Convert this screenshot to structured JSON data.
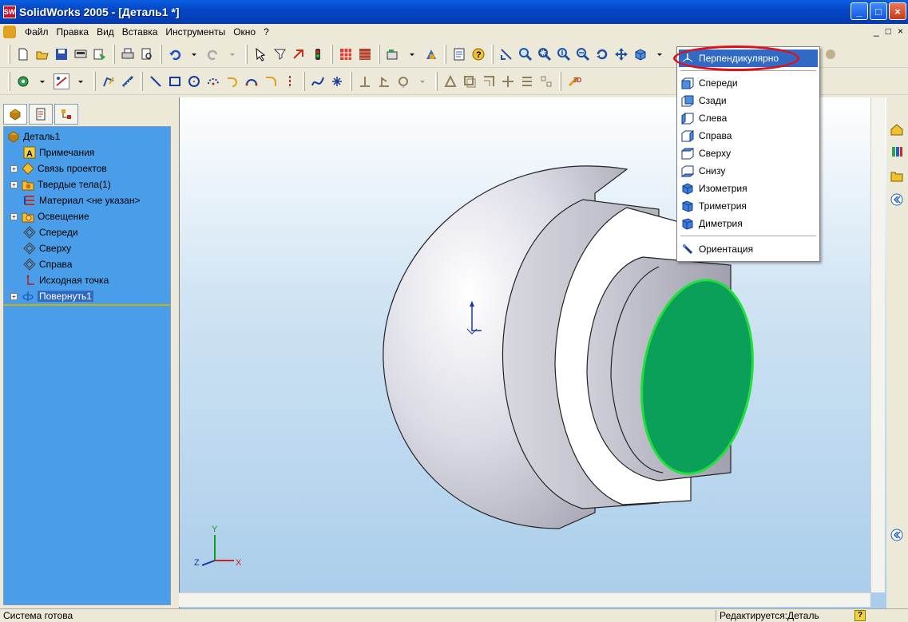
{
  "window": {
    "title": "SolidWorks 2005 - [Деталь1 *]",
    "logo_text": "SW",
    "minimize": "_",
    "maximize": "□",
    "close": "×"
  },
  "menu": {
    "items": [
      "Файл",
      "Правка",
      "Вид",
      "Вставка",
      "Инструменты",
      "Окно",
      "?"
    ],
    "mdi": [
      "_",
      "□",
      "×"
    ]
  },
  "feature_tree": {
    "items": [
      {
        "label": "Деталь1",
        "icon": "part-icon",
        "expander": false
      },
      {
        "label": "Примечания",
        "icon": "annotations-icon",
        "expander": false
      },
      {
        "label": "Связь проектов",
        "icon": "design-binder-icon",
        "expander": true
      },
      {
        "label": "Твердые тела(1)",
        "icon": "solid-bodies-icon",
        "expander": true
      },
      {
        "label": "Материал <не указан>",
        "icon": "material-icon",
        "expander": false
      },
      {
        "label": "Освещение",
        "icon": "lighting-icon",
        "expander": true
      },
      {
        "label": "Спереди",
        "icon": "plane-icon",
        "expander": false
      },
      {
        "label": "Сверху",
        "icon": "plane-icon",
        "expander": false
      },
      {
        "label": "Справа",
        "icon": "plane-icon",
        "expander": false
      },
      {
        "label": "Исходная точка",
        "icon": "origin-icon",
        "expander": false
      },
      {
        "label": "Повернуть1",
        "icon": "revolve-icon",
        "expander": true,
        "selected": true
      }
    ]
  },
  "view_menu": {
    "highlighted": "Перпендикулярно",
    "group1": [
      "Спереди",
      "Сзади",
      "Слева",
      "Справа",
      "Сверху",
      "Снизу"
    ],
    "group2": [
      "Изометрия",
      "Триметрия",
      "Диметрия"
    ],
    "footer": "Ориентация"
  },
  "axes": {
    "x": "X",
    "y": "Y",
    "z": "Z"
  },
  "status": {
    "left": "Система готова",
    "right": "Редактируется:Деталь",
    "help": "?"
  },
  "colors": {
    "face_highlight": "#0aa05a",
    "face_edge": "#22e03a",
    "tree_bg": "#4a9de8",
    "annotation_ellipse": "#e0101a"
  }
}
